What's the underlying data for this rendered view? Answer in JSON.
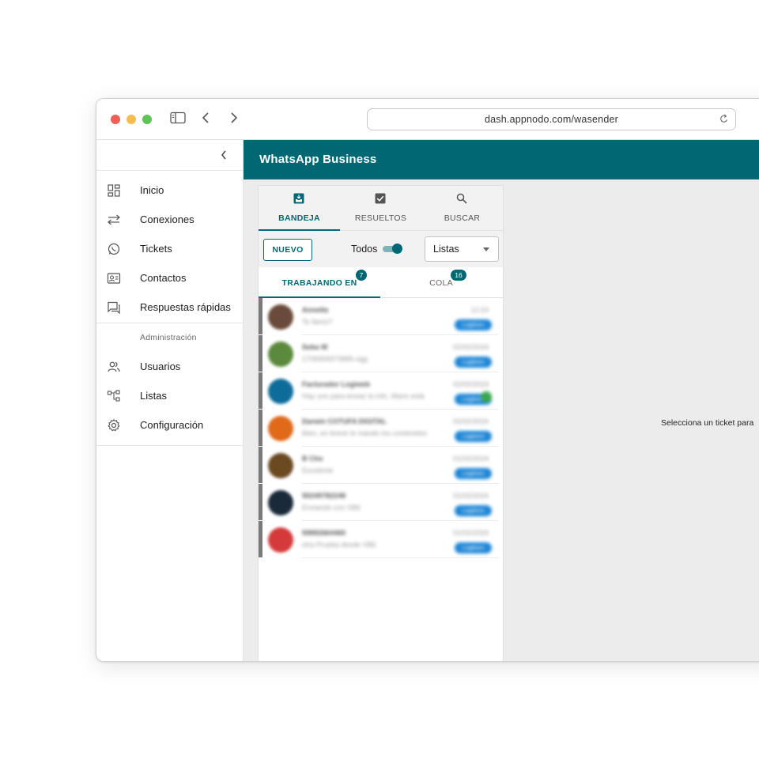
{
  "browser": {
    "url": "dash.appnodo.com/wasender"
  },
  "sidebar": {
    "items": [
      {
        "label": "Inicio",
        "icon": "dashboard-icon"
      },
      {
        "label": "Conexiones",
        "icon": "swap-icon"
      },
      {
        "label": "Tickets",
        "icon": "whatsapp-icon"
      },
      {
        "label": "Contactos",
        "icon": "contact-card-icon"
      },
      {
        "label": "Respuestas rápidas",
        "icon": "quick-reply-icon"
      }
    ],
    "section_label": "Administración",
    "admin_items": [
      {
        "label": "Usuarios",
        "icon": "users-icon"
      },
      {
        "label": "Listas",
        "icon": "tree-icon"
      },
      {
        "label": "Configuración",
        "icon": "gear-icon"
      }
    ]
  },
  "appbar": {
    "title": "WhatsApp Business"
  },
  "tabs": [
    {
      "label": "BANDEJA",
      "icon": "inbox-icon",
      "active": true
    },
    {
      "label": "RESUELTOS",
      "icon": "check-box-icon",
      "active": false
    },
    {
      "label": "BUSCAR",
      "icon": "search-icon",
      "active": false
    }
  ],
  "toolbar": {
    "new_label": "NUEVO",
    "todos_label": "Todos",
    "todos_enabled": true,
    "select_value": "Listas"
  },
  "subtabs": [
    {
      "label": "TRABAJANDO EN",
      "badge": "7",
      "active": true
    },
    {
      "label": "COLA",
      "badge": "16",
      "active": false
    }
  ],
  "tickets": [
    {
      "name": "Annette",
      "time": "12:24",
      "message": "Te llamo?",
      "tag": "Logikom",
      "avatar_color": "#6a4a3a"
    },
    {
      "name": "Seba W",
      "time": "02/02/2024",
      "message": "1706906973886.ogg",
      "tag": "Logikom",
      "avatar_color": "#5b8a3d"
    },
    {
      "name": "Facturador Logiweb",
      "time": "02/02/2024",
      "message": "Hay uno para enviar la info, Mario está",
      "tag": "Logikom",
      "avatar_color": "#0d6c9a"
    },
    {
      "name": "Darwin COTUFA DIGITAL",
      "time": "02/02/2024",
      "message": "Bien, en breve te mando los contenidos",
      "tag": "Logikom",
      "avatar_color": "#e0691a"
    },
    {
      "name": "B Cho",
      "time": "01/02/2024",
      "message": "Excelente",
      "tag": "Logikom",
      "avatar_color": "#6b4a22"
    },
    {
      "name": "50249782248",
      "time": "01/02/2024",
      "message": "Enviando con VB6",
      "tag": "Logikom",
      "avatar_color": "#1a2a3a"
    },
    {
      "name": "59892664460",
      "time": "01/02/2024",
      "message": "otra Prueba desde VB6",
      "tag": "Logikom",
      "avatar_color": "#d43a3a"
    }
  ],
  "empty_state": "Selecciona un ticket para",
  "colors": {
    "primary": "#016873",
    "tag": "#1f86d6"
  }
}
